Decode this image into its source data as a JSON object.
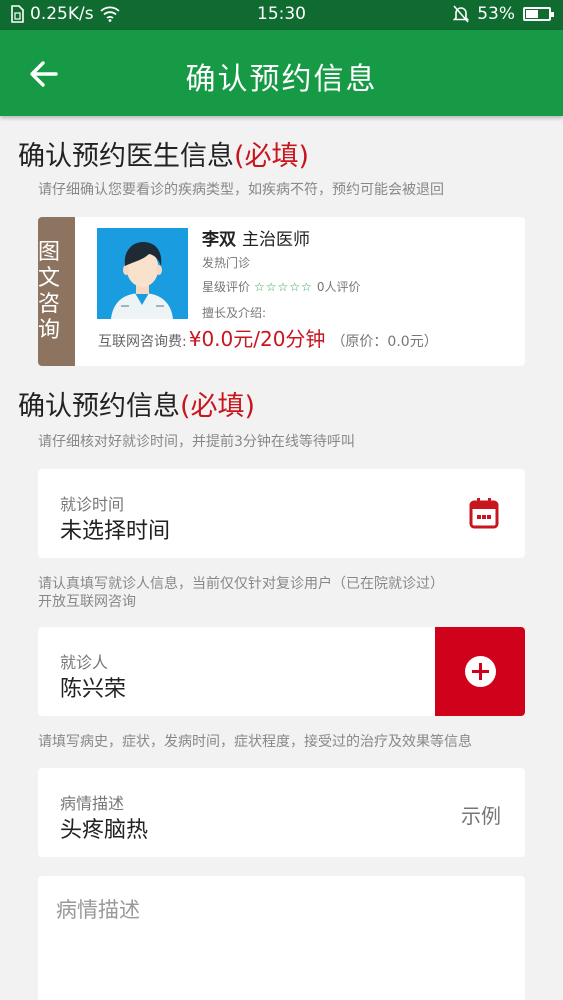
{
  "status_bar": {
    "speed": "0.25K/s",
    "time": "15:30",
    "battery": "53%",
    "battery_level": 0.53
  },
  "app_bar": {
    "title": "确认预约信息"
  },
  "doctor_section": {
    "title": "确认预约医生信息",
    "required": "(必填)",
    "hint": "请仔细确认您要看诊的疾病类型，如疾病不符，预约可能会被退回"
  },
  "doctor": {
    "tag_lines": [
      "图文",
      "咨询"
    ],
    "name": "李双",
    "title": "主治医师",
    "department": "发热门诊",
    "rating_label": "星级评价",
    "stars": "☆☆☆☆☆",
    "review_count": "0人评价",
    "skill_label": "擅长及介绍:",
    "fee_label": "互联网咨询费:",
    "fee_price": "¥0.0元/20分钟",
    "original_price": "（原价：0.0元）"
  },
  "appointment_section": {
    "title": "确认预约信息",
    "required": "(必填)",
    "hint": "请仔细核对好就诊时间，并提前3分钟在线等待呼叫"
  },
  "visit_time": {
    "label": "就诊时间",
    "value": "未选择时间"
  },
  "patient_hint_lines": [
    "请认真填写就诊人信息，当前仅仅针对复诊用户（已在院就诊过）",
    "开放互联网咨询"
  ],
  "patient": {
    "label": "就诊人",
    "value": "陈兴荣"
  },
  "condition_hint": "请填写病史，症状，发病时间，症状程度，接受过的治疗及效果等信息",
  "condition": {
    "label": "病情描述",
    "value": "头疼脑热",
    "example": "示例"
  },
  "description": {
    "placeholder": "病情描述"
  },
  "colors": {
    "status_bar": "#0f6b2f",
    "app_bar": "#179a45",
    "required": "#c9151e",
    "add_button": "#d0021b",
    "tag": "#8c7460"
  }
}
